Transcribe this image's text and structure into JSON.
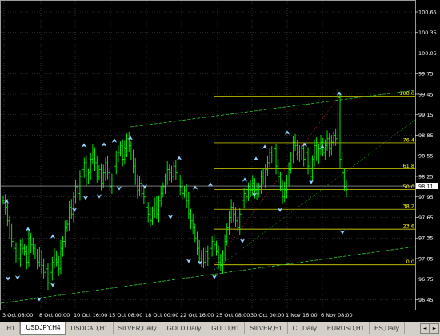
{
  "chart": {
    "symbol": "USDJPY",
    "timeframe": "H4",
    "colors": {
      "background": "#000000",
      "grid": "#4a4a4a",
      "bar": "#00ff00",
      "fib": "#ffff00",
      "channel": "#32cd32",
      "current_price_bg": "#ffffff"
    },
    "price_scale": [
      "100.65",
      "100.35",
      "100.05",
      "99.75",
      "99.45",
      "99.15",
      "98.85",
      "98.55",
      "98.25",
      "97.95",
      "97.65",
      "97.35",
      "97.05",
      "96.75",
      "96.45"
    ],
    "current_price": "98.11",
    "time_axis": [
      "3 Oct 08:00",
      "8 Oct 00:00",
      "10 Oct 16:00",
      "15 Oct 08:00",
      "18 Oct 00:00",
      "22 Oct 16:00",
      "25 Oct 08:00",
      "30 Oct 00:00",
      "1 Nov 16:00",
      "6 Nov 08:00"
    ],
    "fibonacci_levels": [
      {
        "label": "100.0",
        "price": 99.42
      },
      {
        "label": "76.4",
        "price": 98.74
      },
      {
        "label": "61.8",
        "price": 98.36
      },
      {
        "label": "50.0",
        "price": 98.06
      },
      {
        "label": "38.2",
        "price": 97.77
      },
      {
        "label": "23.6",
        "price": 97.48
      },
      {
        "label": "0.0",
        "price": 96.96
      }
    ],
    "fractal_icon": "arrow-icon"
  },
  "tabs": [
    {
      "label": ",H1",
      "active": false
    },
    {
      "label": "USDJPY,H4",
      "active": true
    },
    {
      "label": "USDCAD,H1",
      "active": false
    },
    {
      "label": "SILVER,Daily",
      "active": false
    },
    {
      "label": "GOLD,Daily",
      "active": false
    },
    {
      "label": "GOLD,H1",
      "active": false
    },
    {
      "label": "SILVER,H1",
      "active": false
    },
    {
      "label": "CL,Daily",
      "active": false
    },
    {
      "label": "EURUSD,H1",
      "active": false
    },
    {
      "label": "ES,Daily",
      "active": false
    }
  ],
  "tab_scroll": {
    "left": "◄",
    "right": "►"
  }
}
